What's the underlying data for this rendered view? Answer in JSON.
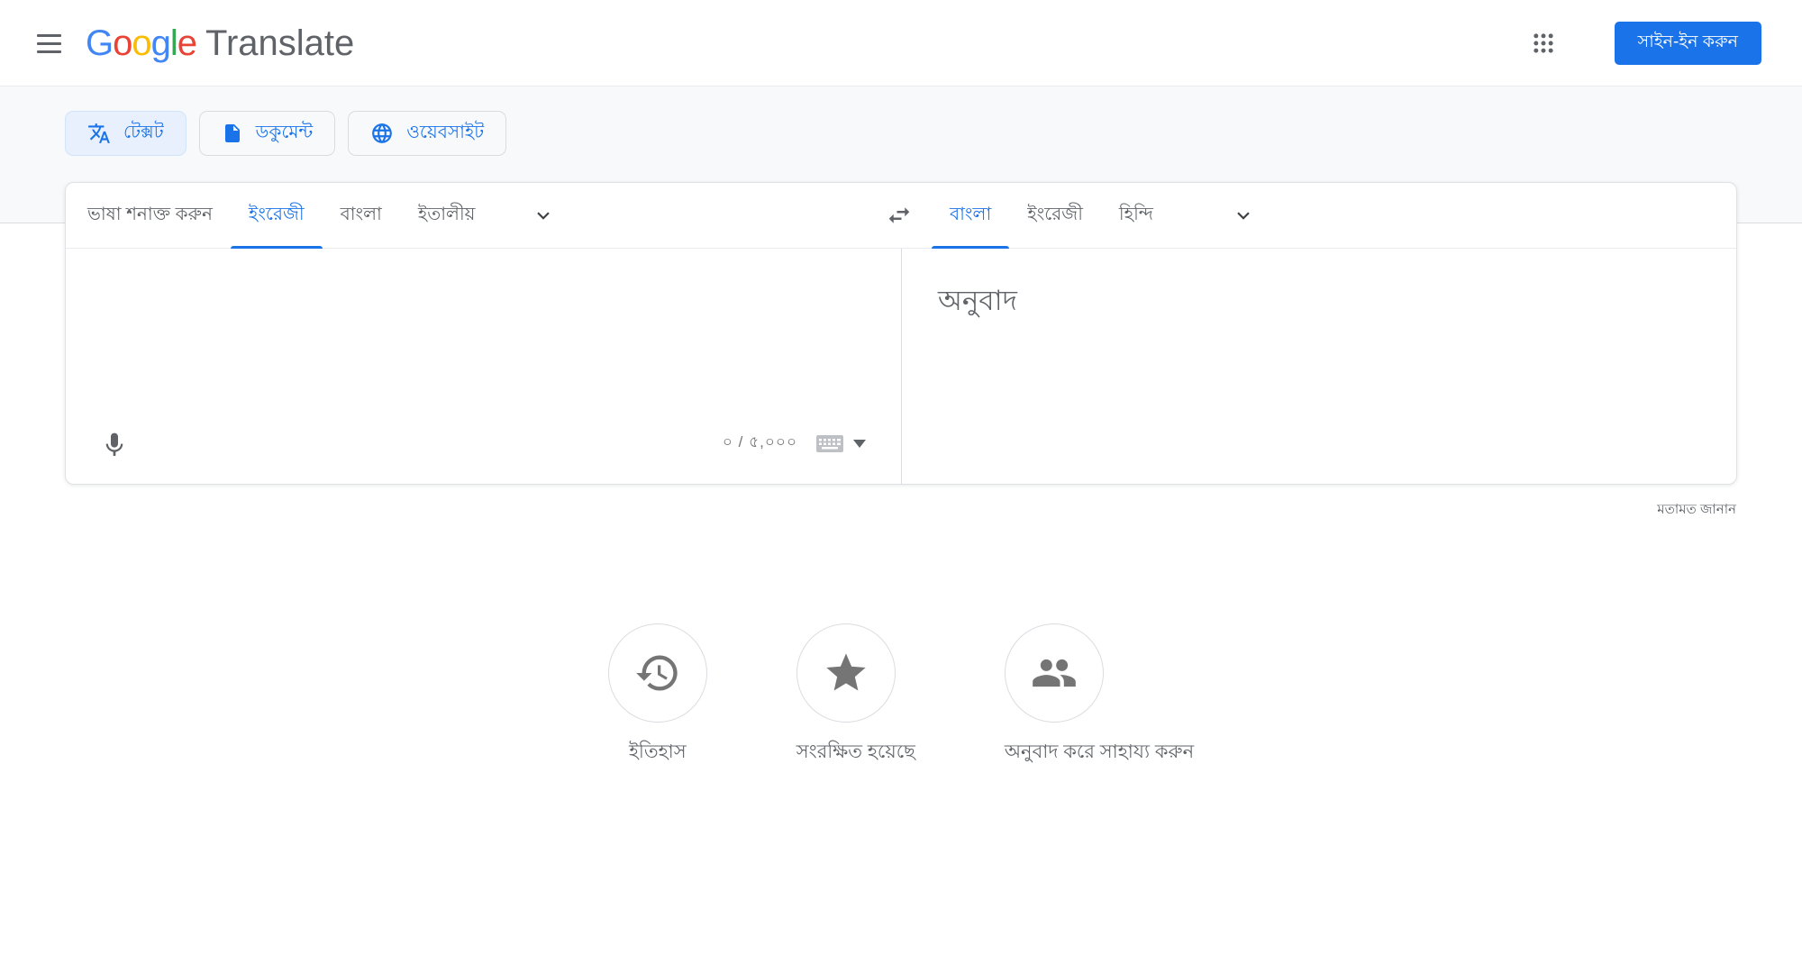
{
  "header": {
    "menu_tooltip": "menu",
    "logo": {
      "letters": [
        {
          "ch": "G",
          "style": "color:#4285f4"
        },
        {
          "ch": "o",
          "style": "color:#ea4335"
        },
        {
          "ch": "o",
          "style": "color:#fbbc04"
        },
        {
          "ch": "g",
          "style": "color:#4285f4"
        },
        {
          "ch": "l",
          "style": "color:#34a853"
        },
        {
          "ch": "e",
          "style": "color:#ea4335"
        }
      ],
      "product": "Translate"
    },
    "signin_label": "সাইন-ইন করুন"
  },
  "mode_tabs": [
    {
      "label": "টেক্সট",
      "icon": "translate-icon",
      "selected": true
    },
    {
      "label": "ডকুমেন্ট",
      "icon": "document-icon",
      "selected": false
    },
    {
      "label": "ওয়েবসাইট",
      "icon": "globe-icon",
      "selected": false
    }
  ],
  "source_panel": {
    "tabs": [
      {
        "label": "ভাষা শনাক্ত করুন",
        "selected": false
      },
      {
        "label": "ইংরেজী",
        "selected": true
      },
      {
        "label": "বাংলা",
        "selected": false
      },
      {
        "label": "ইতালীয়",
        "selected": false
      }
    ],
    "input_value": "",
    "char_counter": "০ / ৫,০০০"
  },
  "target_panel": {
    "tabs": [
      {
        "label": "বাংলা",
        "selected": true
      },
      {
        "label": "ইংরেজী",
        "selected": false
      },
      {
        "label": "হিন্দি",
        "selected": false
      }
    ],
    "placeholder": "অনুবাদ"
  },
  "feedback_label": "মতামত জানান",
  "shortcuts": [
    {
      "label": "ইতিহাস",
      "icon": "history-icon"
    },
    {
      "label": "সংরক্ষিত হয়েছে",
      "icon": "star-icon"
    },
    {
      "label": "অনুবাদ করে সাহায্য করুন",
      "icon": "contribute-icon"
    }
  ],
  "icons": {
    "menu-icon": "hamburger (3 bars)",
    "apps-grid-icon": "3x3 dot grid",
    "translate-icon": "文A translate glyph",
    "document-icon": "filled document",
    "globe-icon": "globe / language",
    "chevron-down-icon": "v chevron",
    "swap-languages-icon": "left-right arrows",
    "mic-icon": "microphone",
    "keyboard-icon": "on-screen keyboard",
    "history-icon": "clock with ccw arrow",
    "star-icon": "star",
    "contribute-icon": "two people"
  },
  "colors": {
    "accent": "#1a73e8",
    "selected_mode_bg": "#e8f0fe",
    "band_bg": "#f8f9fa",
    "border": "#dadce0",
    "text_gray": "#5f6368",
    "icon_gray": "#757575"
  }
}
